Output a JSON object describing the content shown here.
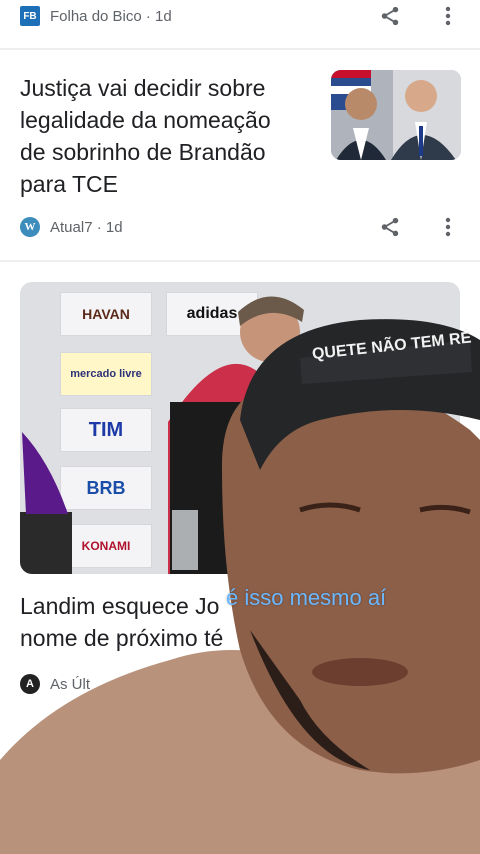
{
  "top_card": {
    "source": "Folha do Bico · 1d",
    "logo_text": "FB"
  },
  "card1": {
    "headline_lines": [
      "Justiça vai decidir sobre",
      "legalidade da nomeação",
      "de sobrinho de Brandão",
      "para TCE"
    ],
    "source": "Atual7 · 1d",
    "logo_text": "W"
  },
  "card2": {
    "headline_lines": [
      "Landim esquece Jo",
      "nome de próximo té"
    ],
    "source": "As Últ",
    "logo_text": "A",
    "sponsors": [
      "HAVAN",
      "adidas",
      "mercado livre",
      "TIM",
      "BRB",
      "KONAMI"
    ]
  },
  "video_overlay": {
    "caption": "é isso mesmo aí",
    "cap_text": "QUETE NÃO TEM RÉ"
  },
  "colors": {
    "accent_link": "#1a73e8",
    "caption": "#6bb8ff",
    "flamengo_red": "#c8102e"
  }
}
